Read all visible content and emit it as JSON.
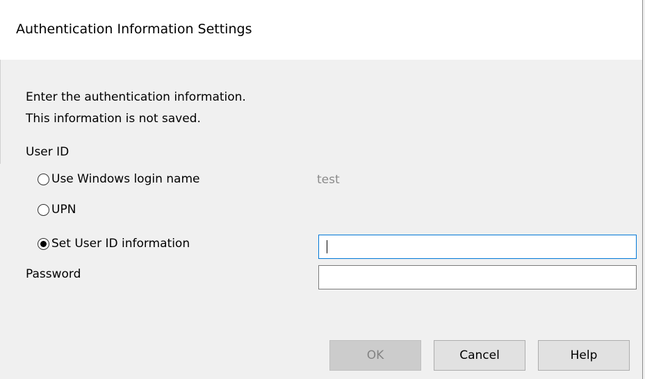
{
  "dialog": {
    "title": "Authentication Information Settings"
  },
  "instructions": {
    "line1": "Enter the authentication information.",
    "line2": "This information is not saved."
  },
  "user_id": {
    "label": "User ID",
    "options": [
      {
        "label": "Use Windows login name",
        "selected": false,
        "value_display": "test"
      },
      {
        "label": "UPN",
        "selected": false
      },
      {
        "label": "Set User ID information",
        "selected": true
      }
    ],
    "input_value": ""
  },
  "password": {
    "label": "Password",
    "input_value": ""
  },
  "buttons": {
    "ok": "OK",
    "cancel": "Cancel",
    "help": "Help"
  },
  "colors": {
    "background": "#f0f0f0",
    "titlebar": "#ffffff",
    "focus_border": "#0078d7",
    "disabled_text": "#838383",
    "readonly_value": "#8a8a8a"
  }
}
